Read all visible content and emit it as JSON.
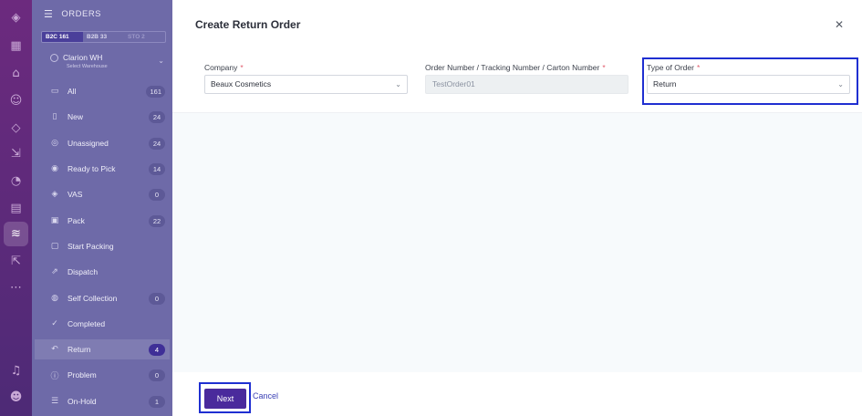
{
  "sidebar": {
    "title": "ORDERS",
    "segments": [
      {
        "label": "B2C",
        "count": "161"
      },
      {
        "label": "B2B",
        "count": "33"
      },
      {
        "label": "STO",
        "count": "2"
      }
    ],
    "warehouse": {
      "name": "Clarion WH",
      "sub": "Select Warehouse"
    },
    "items": [
      {
        "label": "All",
        "count": "161",
        "icon": "monitor-icon"
      },
      {
        "label": "New",
        "count": "24",
        "icon": "document-icon"
      },
      {
        "label": "Unassigned",
        "count": "24",
        "icon": "target-icon"
      },
      {
        "label": "Ready to Pick",
        "count": "14",
        "icon": "ready-icon"
      },
      {
        "label": "VAS",
        "count": "0",
        "icon": "vas-icon"
      },
      {
        "label": "Pack",
        "count": "22",
        "icon": "package-icon"
      },
      {
        "label": "Start Packing",
        "count": "",
        "icon": "box-icon"
      },
      {
        "label": "Dispatch",
        "count": "",
        "icon": "dispatch-icon"
      },
      {
        "label": "Self Collection",
        "count": "0",
        "icon": "self-collection-icon"
      },
      {
        "label": "Completed",
        "count": "",
        "icon": "check-circle-icon"
      },
      {
        "label": "Return",
        "count": "4",
        "icon": "return-icon"
      },
      {
        "label": "Problem",
        "count": "0",
        "icon": "alert-icon"
      },
      {
        "label": "On-Hold",
        "count": "1",
        "icon": "hold-icon"
      }
    ]
  },
  "modal": {
    "title": "Create Return Order",
    "fields": {
      "company": {
        "label": "Company",
        "value": "Beaux Cosmetics"
      },
      "order_number": {
        "label": "Order Number / Tracking Number / Carton Number",
        "value": "TestOrder01"
      },
      "order_type": {
        "label": "Type of Order",
        "value": "Return"
      }
    },
    "required_mark": "*",
    "next_label": "Next",
    "cancel_label": "Cancel"
  },
  "colors": {
    "rail": "#5c2a7a",
    "sidebar_overlay": "#6e6aa8",
    "primary_button": "#4a2a9c",
    "highlight_box": "#1f2fd1",
    "required": "#e15b6b"
  }
}
